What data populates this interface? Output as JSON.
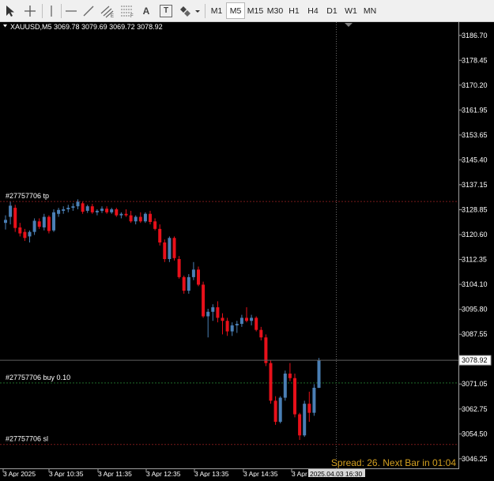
{
  "toolbar": {
    "tools": [
      {
        "name": "cursor-icon"
      },
      {
        "name": "crosshair-icon"
      },
      {
        "name": "vertical-line-icon"
      },
      {
        "name": "horizontal-line-icon"
      },
      {
        "name": "trendline-icon"
      },
      {
        "name": "equidistant-channel-icon"
      },
      {
        "name": "fibonacci-icon"
      },
      {
        "name": "text-icon",
        "label": "A"
      },
      {
        "name": "text-label-icon",
        "label": "T"
      },
      {
        "name": "shapes-icon"
      }
    ],
    "timeframes": [
      "M1",
      "M5",
      "M15",
      "M30",
      "H1",
      "H4",
      "D1",
      "W1",
      "MN"
    ],
    "active_timeframe": "M5"
  },
  "chart": {
    "symbol_header": "XAUUSD,M5  3069.78 3079.69 3069.72 3078.92",
    "current_price_label": "3078.92",
    "spread_text": "Spread: 26. Next Bar in 01:04",
    "crosshair_time_label": "2025.04.03 16:30",
    "order_lines": [
      {
        "label": "#27757706 tp",
        "price": 3131.6
      },
      {
        "label": "#27757706 buy 0.10",
        "price": 3071.4
      },
      {
        "label": "#27757706 sl",
        "price": 3051.0
      }
    ],
    "colors": {
      "bull": "#4a7fb5",
      "bear": "#e8101a",
      "background": "#000000",
      "spread_text": "#d4a020"
    }
  },
  "chart_data": {
    "type": "candlestick",
    "y_ticks": [
      "3186.70",
      "3178.45",
      "3170.20",
      "3161.95",
      "3153.65",
      "3145.40",
      "3137.15",
      "3128.85",
      "3120.60",
      "3112.35",
      "3104.10",
      "3095.80",
      "3087.55",
      "3079.30",
      "3071.05",
      "3062.75",
      "3054.50",
      "3046.25"
    ],
    "ylim": [
      3042.8,
      3191.1
    ],
    "x_tick_labels": [
      "3 Apr 2025",
      "3 Apr 10:35",
      "3 Apr 11:35",
      "3 Apr 12:35",
      "3 Apr 13:35",
      "3 Apr 14:35",
      "3 Apr 15:35"
    ],
    "candles": [
      {
        "o": 3124.5,
        "h": 3127.0,
        "l": 3122.3,
        "c": 3125.5
      },
      {
        "o": 3126.5,
        "h": 3131.5,
        "l": 3124.0,
        "c": 3130.2
      },
      {
        "o": 3129.5,
        "h": 3130.5,
        "l": 3121.5,
        "c": 3122.8
      },
      {
        "o": 3123.0,
        "h": 3124.5,
        "l": 3120.0,
        "c": 3121.0
      },
      {
        "o": 3121.5,
        "h": 3122.5,
        "l": 3118.5,
        "c": 3119.5
      },
      {
        "o": 3120.0,
        "h": 3122.0,
        "l": 3118.0,
        "c": 3121.5
      },
      {
        "o": 3121.5,
        "h": 3126.0,
        "l": 3120.5,
        "c": 3125.2
      },
      {
        "o": 3125.0,
        "h": 3126.0,
        "l": 3122.5,
        "c": 3123.2
      },
      {
        "o": 3123.0,
        "h": 3127.5,
        "l": 3122.0,
        "c": 3126.5
      },
      {
        "o": 3126.5,
        "h": 3127.0,
        "l": 3121.0,
        "c": 3121.8
      },
      {
        "o": 3122.0,
        "h": 3129.0,
        "l": 3121.5,
        "c": 3128.0
      },
      {
        "o": 3127.5,
        "h": 3129.5,
        "l": 3126.5,
        "c": 3128.8
      },
      {
        "o": 3128.5,
        "h": 3130.0,
        "l": 3127.5,
        "c": 3129.0
      },
      {
        "o": 3129.0,
        "h": 3130.5,
        "l": 3128.0,
        "c": 3129.5
      },
      {
        "o": 3129.5,
        "h": 3131.0,
        "l": 3128.5,
        "c": 3130.0
      },
      {
        "o": 3130.0,
        "h": 3132.3,
        "l": 3129.0,
        "c": 3131.5
      },
      {
        "o": 3131.0,
        "h": 3131.5,
        "l": 3127.5,
        "c": 3128.2
      },
      {
        "o": 3128.5,
        "h": 3130.5,
        "l": 3127.8,
        "c": 3130.0
      },
      {
        "o": 3130.0,
        "h": 3130.8,
        "l": 3127.5,
        "c": 3128.0
      },
      {
        "o": 3128.0,
        "h": 3129.0,
        "l": 3127.0,
        "c": 3128.5
      },
      {
        "o": 3128.5,
        "h": 3130.0,
        "l": 3127.8,
        "c": 3129.2
      },
      {
        "o": 3129.2,
        "h": 3130.0,
        "l": 3127.5,
        "c": 3128.0
      },
      {
        "o": 3128.0,
        "h": 3129.5,
        "l": 3127.5,
        "c": 3129.0
      },
      {
        "o": 3129.0,
        "h": 3129.5,
        "l": 3126.5,
        "c": 3127.0
      },
      {
        "o": 3127.0,
        "h": 3128.0,
        "l": 3126.0,
        "c": 3127.5
      },
      {
        "o": 3127.5,
        "h": 3129.0,
        "l": 3126.5,
        "c": 3127.0
      },
      {
        "o": 3127.0,
        "h": 3128.5,
        "l": 3124.5,
        "c": 3125.0
      },
      {
        "o": 3125.0,
        "h": 3127.0,
        "l": 3124.0,
        "c": 3126.5
      },
      {
        "o": 3126.5,
        "h": 3128.0,
        "l": 3124.5,
        "c": 3125.0
      },
      {
        "o": 3125.0,
        "h": 3128.0,
        "l": 3124.5,
        "c": 3127.5
      },
      {
        "o": 3127.5,
        "h": 3128.5,
        "l": 3124.0,
        "c": 3124.8
      },
      {
        "o": 3125.0,
        "h": 3126.0,
        "l": 3122.0,
        "c": 3122.5
      },
      {
        "o": 3122.5,
        "h": 3124.0,
        "l": 3117.0,
        "c": 3118.0
      },
      {
        "o": 3118.0,
        "h": 3119.0,
        "l": 3111.5,
        "c": 3112.5
      },
      {
        "o": 3112.5,
        "h": 3120.0,
        "l": 3111.5,
        "c": 3119.5
      },
      {
        "o": 3119.5,
        "h": 3120.0,
        "l": 3112.0,
        "c": 3112.8
      },
      {
        "o": 3112.5,
        "h": 3113.5,
        "l": 3106.0,
        "c": 3106.5
      },
      {
        "o": 3106.5,
        "h": 3107.0,
        "l": 3101.0,
        "c": 3102.0
      },
      {
        "o": 3102.0,
        "h": 3107.5,
        "l": 3101.0,
        "c": 3106.5
      },
      {
        "o": 3106.5,
        "h": 3111.5,
        "l": 3105.5,
        "c": 3109.0
      },
      {
        "o": 3109.0,
        "h": 3110.0,
        "l": 3103.5,
        "c": 3104.0
      },
      {
        "o": 3104.0,
        "h": 3105.0,
        "l": 3093.0,
        "c": 3093.5
      },
      {
        "o": 3093.5,
        "h": 3096.0,
        "l": 3086.5,
        "c": 3095.0
      },
      {
        "o": 3095.0,
        "h": 3097.5,
        "l": 3092.0,
        "c": 3096.5
      },
      {
        "o": 3096.5,
        "h": 3098.5,
        "l": 3091.5,
        "c": 3093.0
      },
      {
        "o": 3093.0,
        "h": 3094.5,
        "l": 3087.5,
        "c": 3092.0
      },
      {
        "o": 3092.0,
        "h": 3093.0,
        "l": 3087.0,
        "c": 3088.5
      },
      {
        "o": 3088.5,
        "h": 3091.5,
        "l": 3087.0,
        "c": 3090.5
      },
      {
        "o": 3090.5,
        "h": 3092.0,
        "l": 3088.0,
        "c": 3091.0
      },
      {
        "o": 3091.0,
        "h": 3094.0,
        "l": 3090.0,
        "c": 3093.0
      },
      {
        "o": 3093.0,
        "h": 3096.5,
        "l": 3091.5,
        "c": 3092.0
      },
      {
        "o": 3092.0,
        "h": 3094.0,
        "l": 3090.5,
        "c": 3093.0
      },
      {
        "o": 3093.0,
        "h": 3093.5,
        "l": 3088.5,
        "c": 3089.0
      },
      {
        "o": 3089.0,
        "h": 3090.0,
        "l": 3085.5,
        "c": 3086.5
      },
      {
        "o": 3086.5,
        "h": 3087.5,
        "l": 3077.0,
        "c": 3078.0
      },
      {
        "o": 3078.0,
        "h": 3079.0,
        "l": 3064.5,
        "c": 3065.5
      },
      {
        "o": 3065.5,
        "h": 3067.0,
        "l": 3057.5,
        "c": 3058.5
      },
      {
        "o": 3058.5,
        "h": 3067.0,
        "l": 3058.0,
        "c": 3066.5
      },
      {
        "o": 3066.5,
        "h": 3075.5,
        "l": 3065.5,
        "c": 3074.5
      },
      {
        "o": 3074.5,
        "h": 3078.0,
        "l": 3072.0,
        "c": 3073.0
      },
      {
        "o": 3073.0,
        "h": 3074.5,
        "l": 3060.0,
        "c": 3061.0
      },
      {
        "o": 3061.0,
        "h": 3061.5,
        "l": 3052.5,
        "c": 3054.0
      },
      {
        "o": 3054.0,
        "h": 3065.5,
        "l": 3053.5,
        "c": 3064.5
      },
      {
        "o": 3064.5,
        "h": 3068.5,
        "l": 3058.5,
        "c": 3061.5
      },
      {
        "o": 3061.5,
        "h": 3071.0,
        "l": 3060.5,
        "c": 3069.8
      },
      {
        "o": 3069.78,
        "h": 3079.69,
        "l": 3069.72,
        "c": 3078.92
      }
    ]
  }
}
